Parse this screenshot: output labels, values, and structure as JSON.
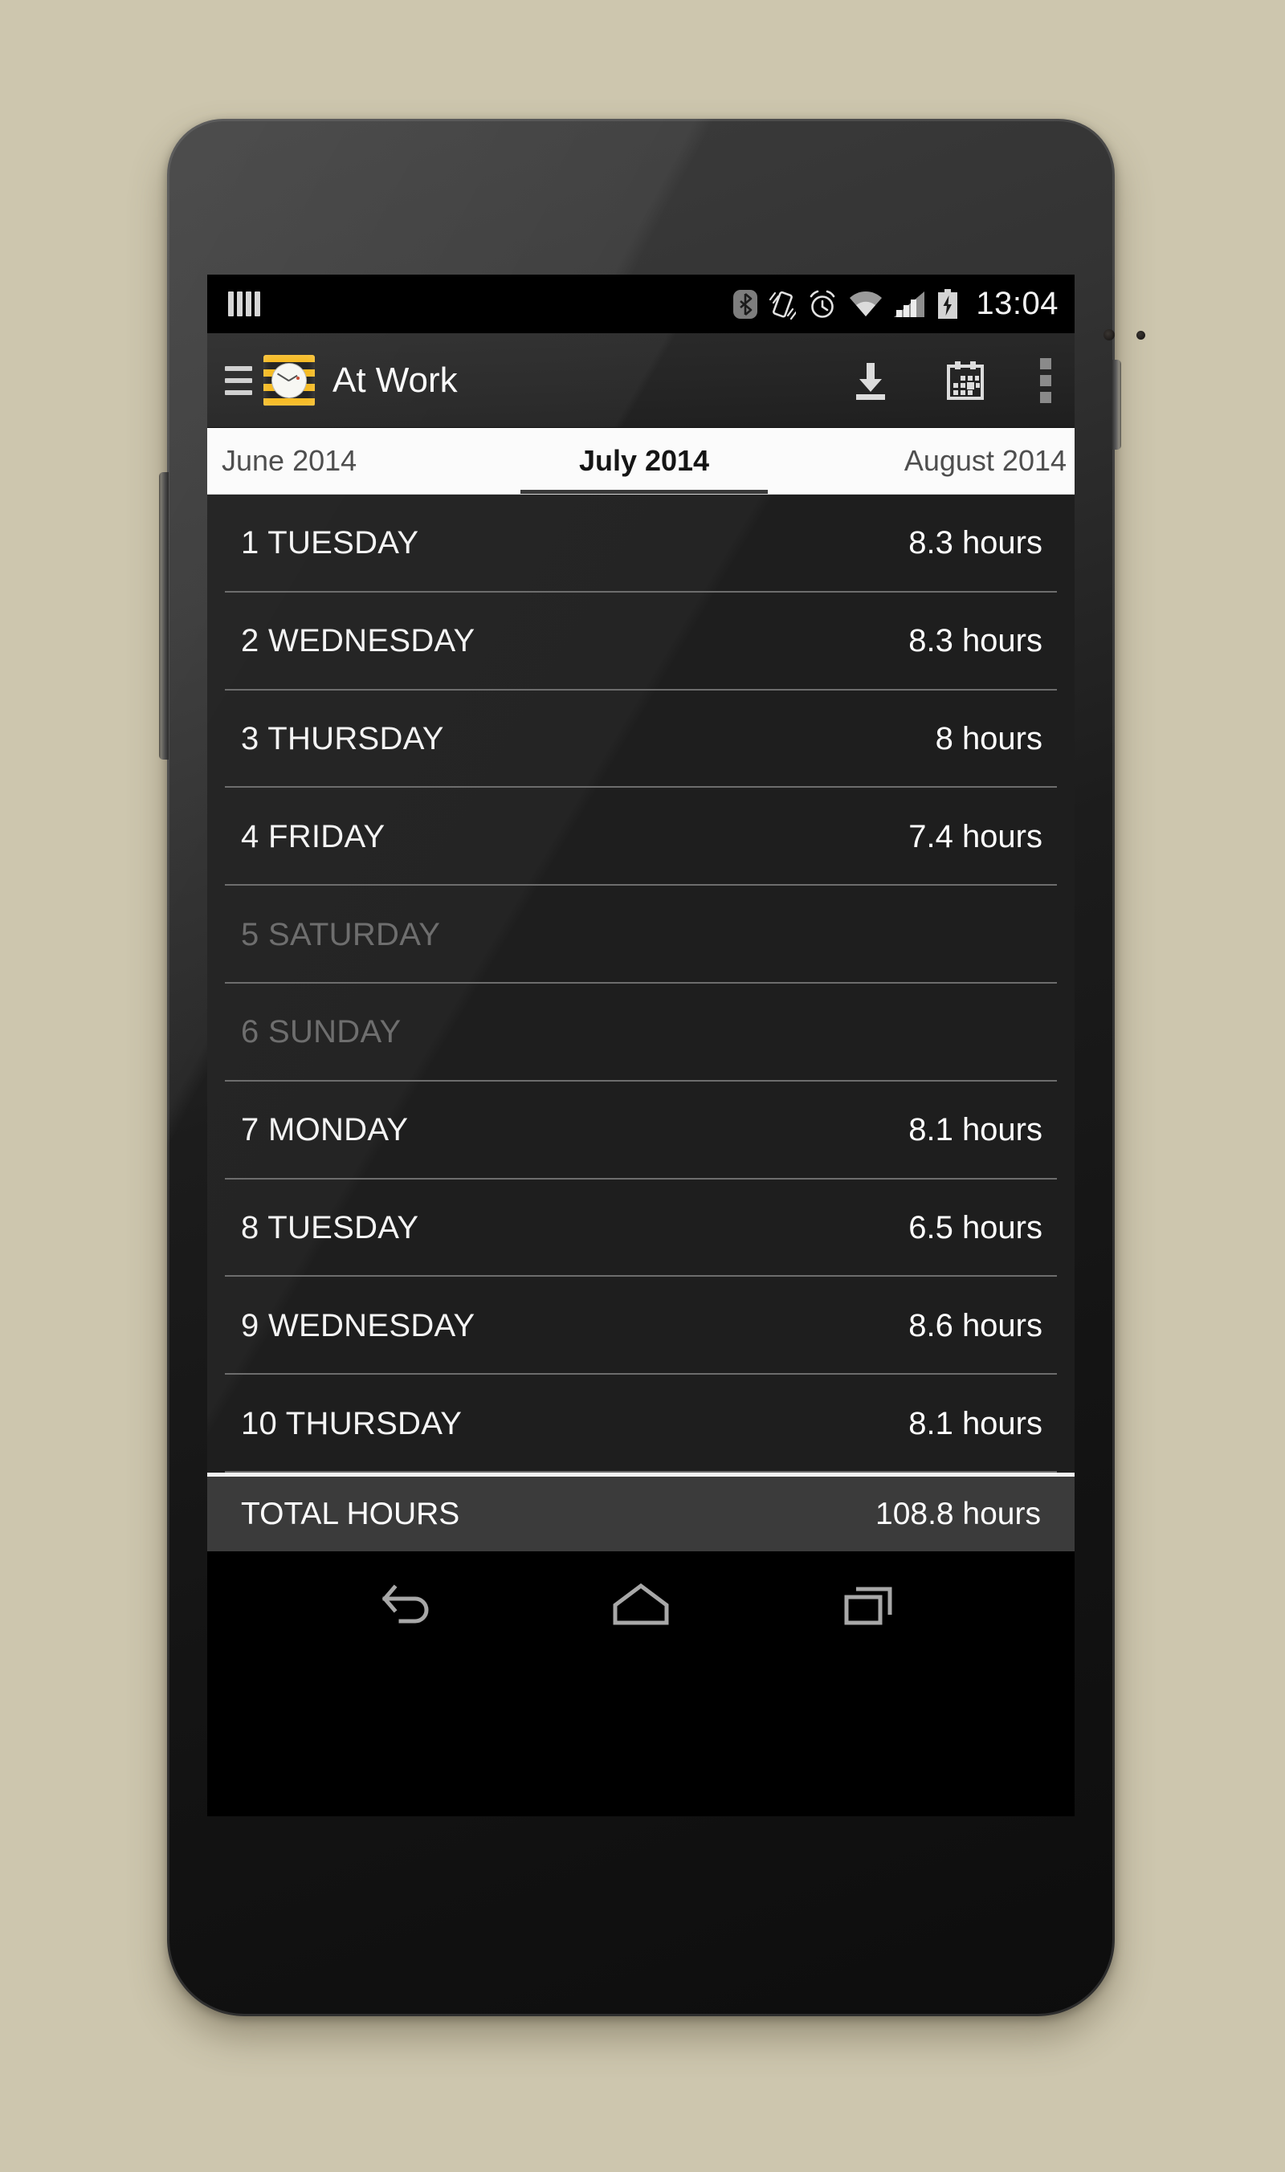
{
  "theme": {
    "page_background": "#cdc6ae",
    "app_bar_background": "#262626",
    "list_background": "#1e1e1e",
    "total_bar_background": "#3b3b3b",
    "accent_icon_yellow": "#f6b81b",
    "disabled_text": "#6e6e6e"
  },
  "status_bar": {
    "notification_icon": "four-bars-icon",
    "icons": [
      "bluetooth-icon",
      "vibrate-icon",
      "alarm-icon",
      "wifi-icon",
      "signal-icon",
      "battery-charging-icon"
    ],
    "time": "13:04"
  },
  "action_bar": {
    "drawer_icon": "hamburger-menu-icon",
    "app_icon": "clock-app-icon",
    "title": "At Work",
    "actions": [
      {
        "name": "download-icon",
        "label": "Download"
      },
      {
        "name": "calendar-icon",
        "label": "Calendar"
      },
      {
        "name": "overflow-menu-icon",
        "label": "More options"
      }
    ]
  },
  "tabs": [
    {
      "label": "June 2014",
      "active": false
    },
    {
      "label": "July 2014",
      "active": true
    },
    {
      "label": "August 2014",
      "active": false
    }
  ],
  "day_list": [
    {
      "day": "1 TUESDAY",
      "hours": "8.3 hours",
      "off": false
    },
    {
      "day": "2 WEDNESDAY",
      "hours": "8.3 hours",
      "off": false
    },
    {
      "day": "3 THURSDAY",
      "hours": "8 hours",
      "off": false
    },
    {
      "day": "4 FRIDAY",
      "hours": "7.4 hours",
      "off": false
    },
    {
      "day": "5 SATURDAY",
      "hours": "",
      "off": true
    },
    {
      "day": "6 SUNDAY",
      "hours": "",
      "off": true
    },
    {
      "day": "7 MONDAY",
      "hours": "8.1 hours",
      "off": false
    },
    {
      "day": "8 TUESDAY",
      "hours": "6.5 hours",
      "off": false
    },
    {
      "day": "9 WEDNESDAY",
      "hours": "8.6 hours",
      "off": false
    },
    {
      "day": "10 THURSDAY",
      "hours": "8.1 hours",
      "off": false
    }
  ],
  "total": {
    "label": "TOTAL HOURS",
    "value": "108.8 hours"
  },
  "nav_bar": [
    {
      "name": "back-icon",
      "label": "Back"
    },
    {
      "name": "home-icon",
      "label": "Home"
    },
    {
      "name": "recents-icon",
      "label": "Recent apps"
    }
  ]
}
